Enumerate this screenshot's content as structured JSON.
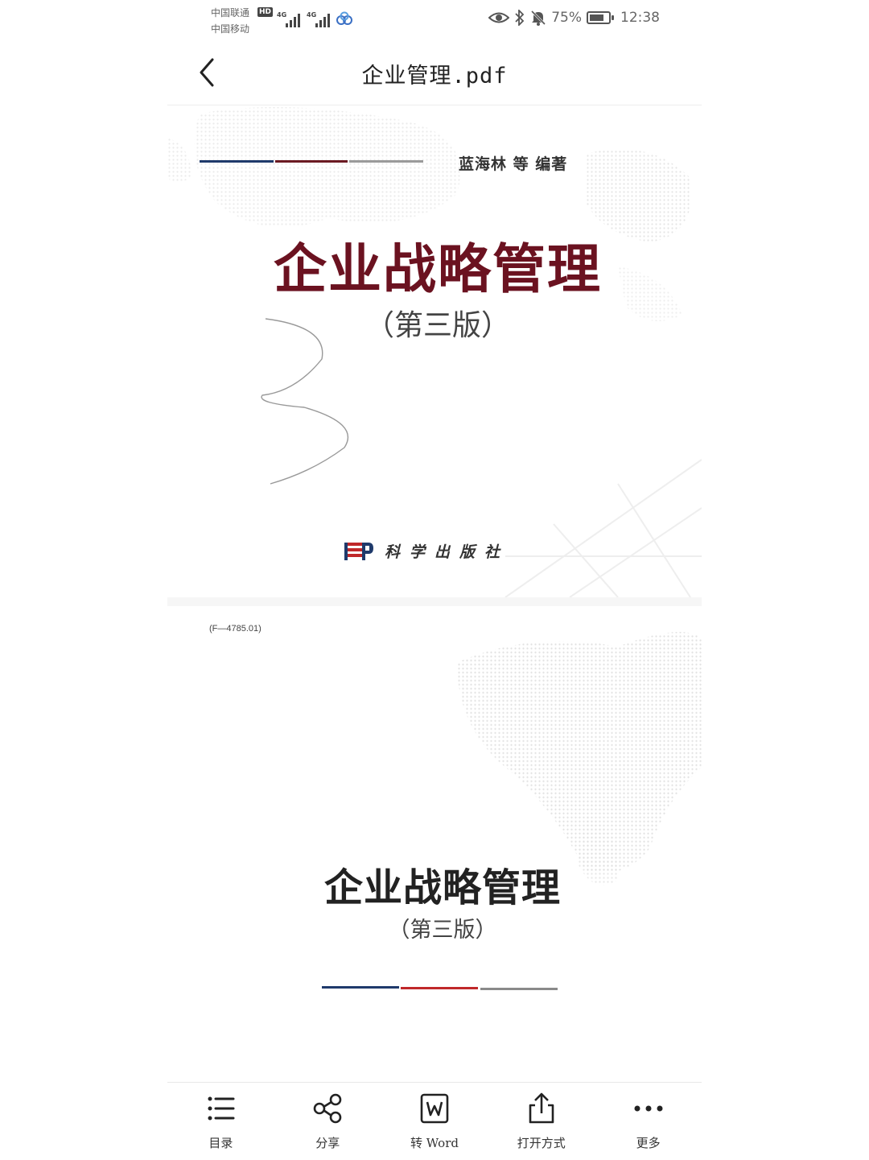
{
  "status_bar": {
    "carrier_1": "中国联通",
    "carrier_2": "中国移动",
    "hd_badge": "HD",
    "network_1": "4G",
    "network_2": "4G",
    "battery_percent": "75%",
    "battery_level": 0.75,
    "time": "12:38",
    "icons": [
      "eye-icon",
      "bluetooth-icon",
      "mute-bell-icon",
      "battery-icon",
      "cloud-icon"
    ]
  },
  "header": {
    "title": "企业管理.pdf",
    "back_icon": "chevron-left-icon"
  },
  "document": {
    "page_1": {
      "authors": "蓝海林 等  编著",
      "title": "企业战略管理",
      "edition": "（第三版）",
      "publisher": "科学出版社",
      "rule_colors": [
        "#1f3a6b",
        "#6b1a22",
        "#9a9a9a"
      ]
    },
    "page_2": {
      "cip_code": "(F—4785.01)",
      "title": "企业战略管理",
      "edition": "（第三版）",
      "rule_colors": [
        "#1f3a6b",
        "#c0282a",
        "#8a8a8a"
      ]
    }
  },
  "toolbar": {
    "items": [
      {
        "label": "目录",
        "icon": "list-icon"
      },
      {
        "label": "分享",
        "icon": "share-icon"
      },
      {
        "label": "转 Word",
        "icon": "word-icon"
      },
      {
        "label": "打开方式",
        "icon": "open-with-icon"
      },
      {
        "label": "更多",
        "icon": "more-icon"
      }
    ]
  },
  "colors": {
    "title_red": "#6b1220",
    "accent_blue": "#1f3a6b"
  }
}
